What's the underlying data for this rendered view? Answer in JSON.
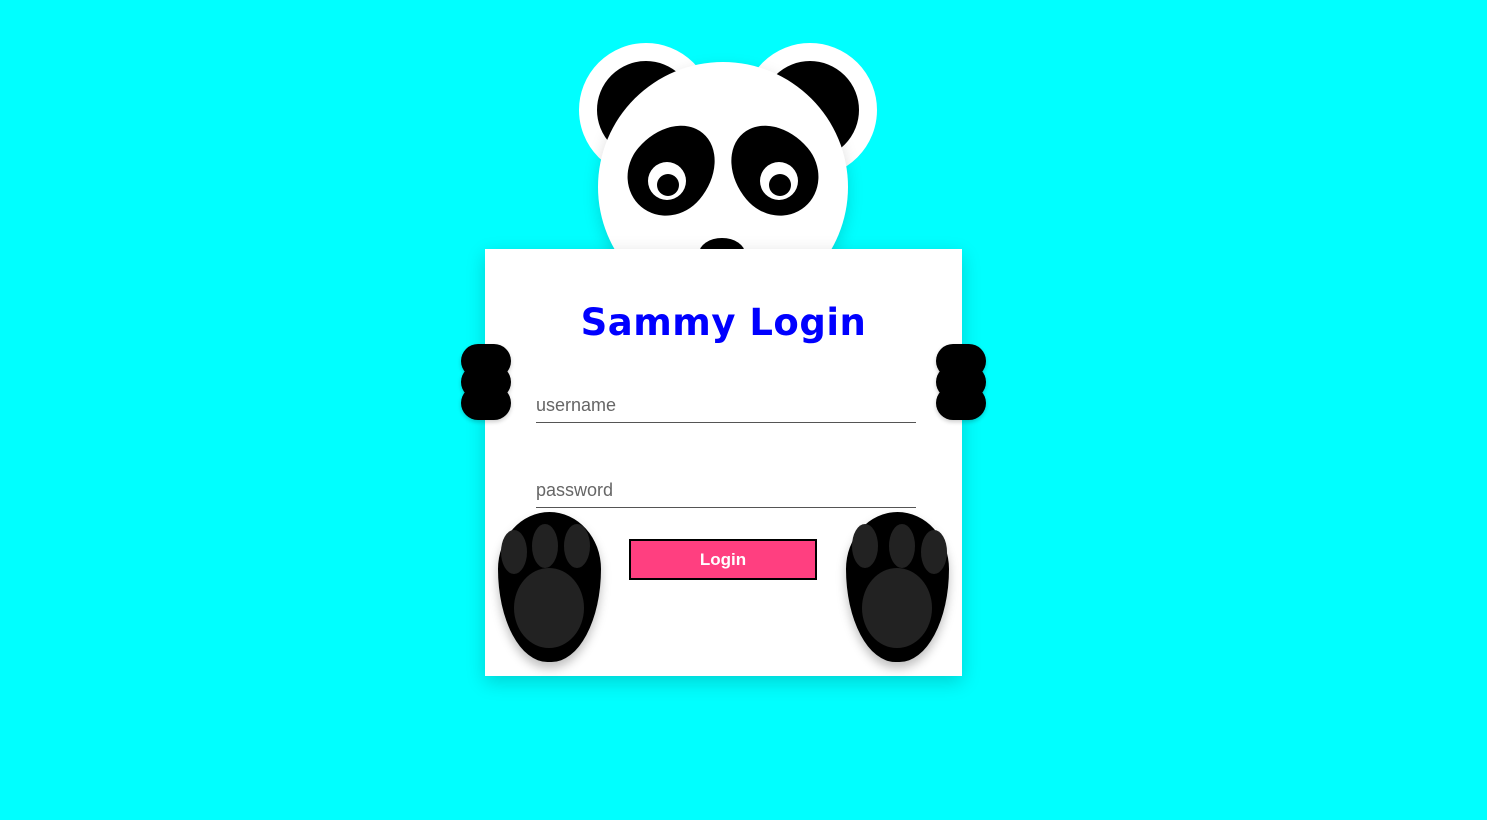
{
  "page": {
    "background_color": "#00ffff"
  },
  "form": {
    "title": "Sammy Login",
    "title_color": "#0000ff",
    "username": {
      "value": "",
      "placeholder": "username"
    },
    "password": {
      "value": "",
      "placeholder": "password"
    },
    "login_button": {
      "label": "Login",
      "color": "#ff3f80"
    }
  },
  "mascot": {
    "icon": "panda-icon"
  }
}
